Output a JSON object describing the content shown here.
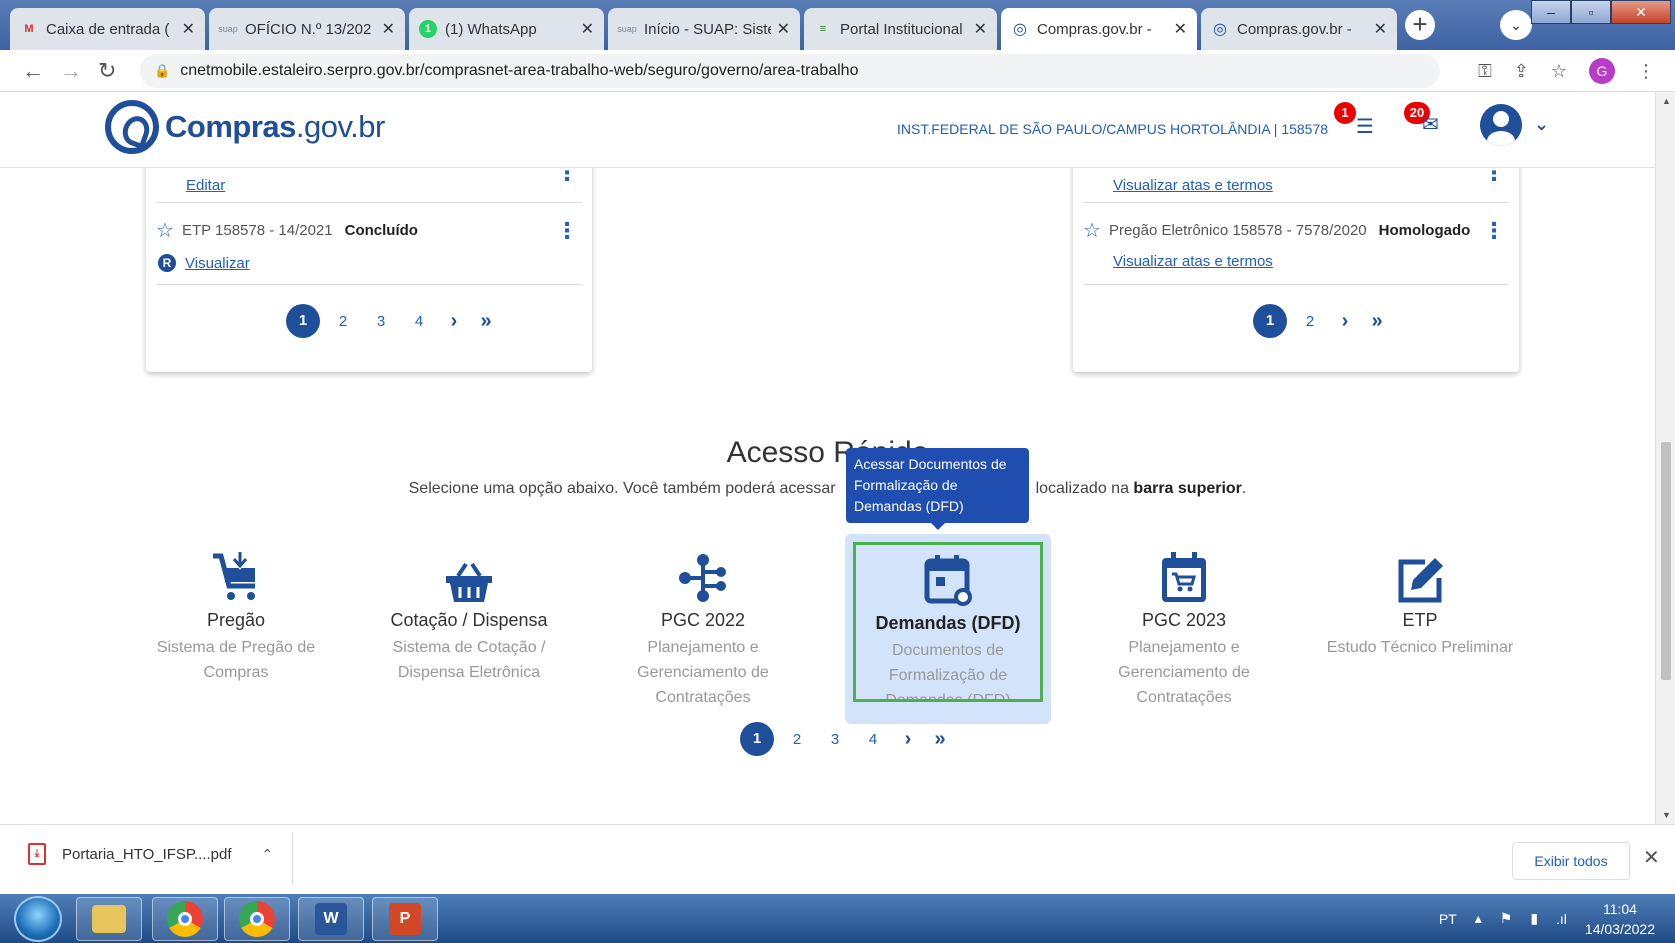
{
  "browser": {
    "tabs": [
      {
        "title": "Caixa de entrada (",
        "favicon": "M"
      },
      {
        "title": "OFÍCIO N.º 13/202",
        "favicon": "suap"
      },
      {
        "title": "(1) WhatsApp",
        "favicon": "1"
      },
      {
        "title": "Início - SUAP: Siste",
        "favicon": "suap"
      },
      {
        "title": "Portal Institucional",
        "favicon": "≡"
      },
      {
        "title": "Compras.gov.br - ",
        "favicon": "◎"
      },
      {
        "title": "Compras.gov.br - ",
        "favicon": "◎"
      }
    ],
    "new_tab": "+",
    "close_glyph": "✕",
    "url": "cnetmobile.estaleiro.serpro.gov.br/comprasnet-area-trabalho-web/seguro/governo/area-trabalho",
    "profile_initial": "G"
  },
  "header": {
    "brand_name": "Compras",
    "brand_domain": ".gov.br",
    "organization": "INST.FEDERAL DE SÃO PAULO/CAMPUS HORTOLÂNDIA | 158578",
    "notifications_count": "1",
    "messages_count": "20"
  },
  "left_card": {
    "top_link": "Editar",
    "item": {
      "label": "ETP 158578 - 14/2021",
      "status": "Concluído",
      "badge": "R",
      "link": "Visualizar"
    },
    "pages": [
      "1",
      "2",
      "3",
      "4"
    ]
  },
  "right_card": {
    "top_link": "Visualizar atas e termos",
    "item": {
      "label": "Pregão Eletrônico 158578 - 7578/2020",
      "status": "Homologado",
      "link": "Visualizar atas e termos"
    },
    "pages": [
      "1",
      "2"
    ]
  },
  "quick_access": {
    "title": "Acesso Rápido",
    "subtitle_pre": "Selecione uma opção abaixo. Você também poderá acessar",
    "subtitle_mid": "localizado na",
    "subtitle_bold": "barra superior",
    "subtitle_end": ".",
    "tooltip": "Acessar Documentos de Formalização de Demandas (DFD)",
    "tiles": [
      {
        "name": "Pregão",
        "desc": "Sistema de Pregão de Compras",
        "icon": "cart-download-icon"
      },
      {
        "name": "Cotação / Dispensa",
        "desc": "Sistema de Cotação / Dispensa Eletrônica",
        "icon": "basket-icon"
      },
      {
        "name": "PGC 2022",
        "desc": "Planejamento e Gerenciamento de Contratações",
        "icon": "sitemap-icon"
      },
      {
        "name": "Demandas (DFD)",
        "desc": "Documentos de Formalização de Demandas (DFD)",
        "icon": "calendar-clock-icon"
      },
      {
        "name": "PGC 2023",
        "desc": "Planejamento e Gerenciamento de Contratações",
        "icon": "calendar-cart-icon"
      },
      {
        "name": "ETP",
        "desc": "Estudo Técnico Preliminar",
        "icon": "edit-icon"
      }
    ],
    "pages": [
      "1",
      "2",
      "3",
      "4"
    ]
  },
  "download_bar": {
    "file": "Portaria_HTO_IFSP....pdf",
    "show_all": "Exibir todos"
  },
  "taskbar": {
    "language": "PT",
    "time": "11:04",
    "date": "14/03/2022"
  },
  "colors": {
    "brand": "#1f4e9a",
    "link": "#1f5fbf",
    "highlight": "#d3e4fa",
    "focus": "#4caf50"
  }
}
